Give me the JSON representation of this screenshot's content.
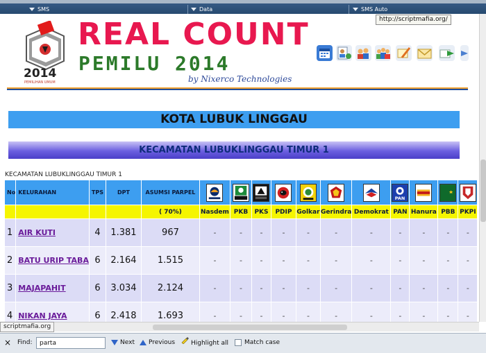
{
  "toolbar": {
    "items": [
      {
        "label": "SMS"
      },
      {
        "label": "Data"
      },
      {
        "label": "SMS Auto"
      }
    ]
  },
  "tooltip": {
    "text": "http://scriptmafia.org/"
  },
  "header": {
    "logo_year": "2014",
    "logo_caption": "PEMILIHAN UMUM",
    "title_line1": "REAL COUNT",
    "title_line2": "PEMILU 2014",
    "byline": "by Nixerco Technologies",
    "icons": [
      "calendar-icon",
      "contacts-icon",
      "group-icon",
      "users-icon",
      "compose-icon",
      "mail-icon",
      "forward-icon",
      "send-icon"
    ]
  },
  "banners": {
    "kota": "KOTA LUBUK LINGGAU",
    "kecamatan": "KECAMATAN LUBUKLINGGAU TIMUR 1",
    "kecamatan_small": "KECAMATAN LUBUKLINGGAU TIMUR 1"
  },
  "table": {
    "headers": {
      "no": "No",
      "kelurahan": "KELURAHAN",
      "tps": "TPS",
      "dpt": "DPT",
      "asumsi": "ASUMSI PARPEL",
      "asumsi_pct": "( 70%)"
    },
    "parties": [
      {
        "name": "Nasdem",
        "logo": "nasdem-logo",
        "color": "#0a2a6b"
      },
      {
        "name": "PKB",
        "logo": "pkb-logo",
        "color": "#1d8b3a"
      },
      {
        "name": "PKS",
        "logo": "pks-logo",
        "color": "#111111"
      },
      {
        "name": "PDIP",
        "logo": "pdip-logo",
        "color": "#d11f1f"
      },
      {
        "name": "Golkar",
        "logo": "golkar-logo",
        "color": "#f2d10a"
      },
      {
        "name": "Gerindra",
        "logo": "gerindra-logo",
        "color": "#c21818"
      },
      {
        "name": "Demokrat",
        "logo": "demokrat-logo",
        "color": "#1a3f9c"
      },
      {
        "name": "PAN",
        "logo": "pan-logo",
        "color": "#1b3fae"
      },
      {
        "name": "Hanura",
        "logo": "hanura-logo",
        "color": "#f3b122"
      },
      {
        "name": "PBB",
        "logo": "pbb-logo",
        "color": "#0f6a2b"
      },
      {
        "name": "PKPI",
        "logo": "pkpi-logo",
        "color": "#c62828"
      }
    ],
    "rows": [
      {
        "no": "1",
        "kelurahan": "AIR KUTI",
        "tps": "4",
        "dpt": "1.381",
        "asumsi": "967"
      },
      {
        "no": "2",
        "kelurahan": "BATU URIP TABA",
        "tps": "6",
        "dpt": "2.164",
        "asumsi": "1.515"
      },
      {
        "no": "3",
        "kelurahan": "MAJAPAHIT",
        "tps": "6",
        "dpt": "3.034",
        "asumsi": "2.124"
      },
      {
        "no": "4",
        "kelurahan": "NIKAN JAYA",
        "tps": "6",
        "dpt": "2.418",
        "asumsi": "1.693"
      }
    ],
    "dash": "-"
  },
  "status": {
    "text": "scriptmafia.org"
  },
  "findbar": {
    "close": "×",
    "label": "Find:",
    "value": "parta",
    "next": "Next",
    "previous": "Previous",
    "highlight": "Highlight all",
    "match_case": "Match case"
  }
}
